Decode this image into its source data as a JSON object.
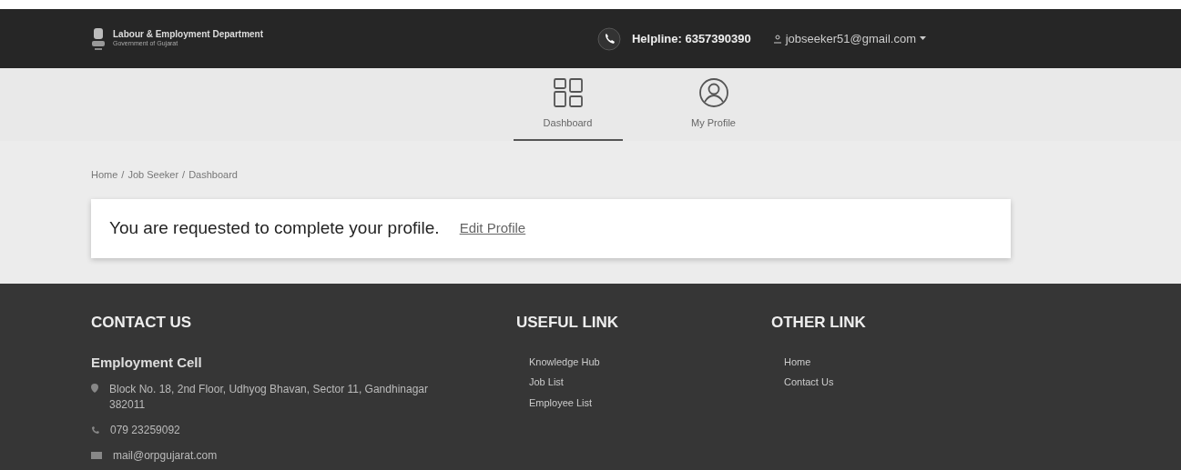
{
  "header": {
    "department": "Labour & Employment Department",
    "subtitle": "Government of Gujarat",
    "helpline": "Helpline: 6357390390",
    "user": "jobseeker51@gmail.com"
  },
  "nav": [
    {
      "label": "Dashboard",
      "kind": "dashboard",
      "selected": true
    },
    {
      "label": "My Profile",
      "kind": "profile",
      "selected": false
    }
  ],
  "breadcrumb": {
    "separator": "/",
    "items": [
      "Home",
      "Job Seeker",
      "Dashboard"
    ]
  },
  "notice": {
    "message": "You are requested to complete your profile.",
    "link": "Edit Profile"
  },
  "footer": {
    "contact": {
      "title": "CONTACT US",
      "name": "Employment Cell",
      "address": "Block No. 18, 2nd Floor, Udhyog Bhavan, Sector 11, Gandhinagar 382011",
      "phone": "079 23259092",
      "email": "mail@orpgujarat.com"
    },
    "useful": {
      "title": "USEFUL LINK",
      "links": [
        "Knowledge Hub",
        "Job List",
        "Employee List"
      ]
    },
    "other": {
      "title": "OTHER LINK",
      "links": [
        "Home",
        "Contact Us"
      ]
    }
  }
}
